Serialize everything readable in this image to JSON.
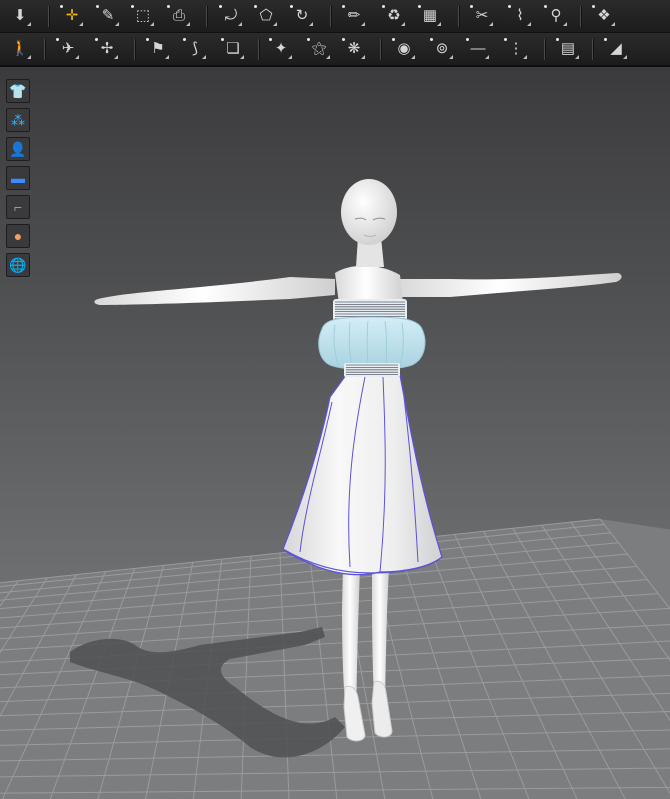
{
  "toolbar_rows": [
    {
      "name": "toolbar-row-1",
      "icons": [
        {
          "name": "download-arrow-icon",
          "glyph": "⬇"
        },
        {
          "name": "transform-move-icon",
          "glyph": "✛",
          "accent": true
        },
        {
          "name": "edit-curve-icon",
          "glyph": "✎"
        },
        {
          "name": "edit-point-icon",
          "glyph": "⬚"
        },
        {
          "name": "edit-texture-icon",
          "glyph": "⎙"
        },
        {
          "name": "segment-icon",
          "glyph": "⤾"
        },
        {
          "name": "polygon-icon",
          "glyph": "⬠"
        },
        {
          "name": "rotate-pattern-icon",
          "glyph": "↻"
        },
        {
          "name": "pencil-icon",
          "glyph": "✏"
        },
        {
          "name": "fold-arrangement-icon",
          "glyph": "♻"
        },
        {
          "name": "fabric-garment-icon",
          "glyph": "▦"
        },
        {
          "name": "sewing-icon",
          "glyph": "✂"
        },
        {
          "name": "free-sewing-icon",
          "glyph": "⌇"
        },
        {
          "name": "garment-fitting-icon",
          "glyph": "⚲"
        },
        {
          "name": "show-garment-icon",
          "glyph": "❖"
        }
      ]
    },
    {
      "name": "toolbar-row-2",
      "icons": [
        {
          "name": "simulation-avatar-icon",
          "glyph": "🚶"
        },
        {
          "name": "arrangement-icon",
          "glyph": "✈"
        },
        {
          "name": "tack-icon",
          "glyph": "✢"
        },
        {
          "name": "pin-icon",
          "glyph": "⚑"
        },
        {
          "name": "fold-icon",
          "glyph": "⟆"
        },
        {
          "name": "layer-icon",
          "glyph": "❏"
        },
        {
          "name": "select-mesh-icon",
          "glyph": "✦"
        },
        {
          "name": "strengthen-icon",
          "glyph": "⚝"
        },
        {
          "name": "pattern-grid-icon",
          "glyph": "❋"
        },
        {
          "name": "button-add-icon",
          "glyph": "◉"
        },
        {
          "name": "button-icon",
          "glyph": "⊚"
        },
        {
          "name": "topstitch-line-icon",
          "glyph": "—"
        },
        {
          "name": "zipper-icon",
          "glyph": "⋮"
        },
        {
          "name": "puckering-icon",
          "glyph": "▤"
        },
        {
          "name": "trim-icon",
          "glyph": "◢"
        }
      ]
    }
  ],
  "side_toolbar": [
    {
      "name": "garment-view-icon",
      "glyph": "👕",
      "color": "#e0e0e0"
    },
    {
      "name": "particle-distance-icon",
      "glyph": "⁂",
      "color": "#37b5ff"
    },
    {
      "name": "avatar-view-icon",
      "glyph": "👤",
      "color": "#e0e0e0"
    },
    {
      "name": "fabric-view-icon",
      "glyph": "▬",
      "color": "#3b8cff"
    },
    {
      "name": "shoe-view-icon",
      "glyph": "⌐",
      "color": "#9a9a9a"
    },
    {
      "name": "avatar-skin-icon",
      "glyph": "●",
      "color": "#f0a060"
    },
    {
      "name": "environment-globe-icon",
      "glyph": "🌐",
      "color": "#3e8ed0"
    }
  ],
  "colors": {
    "accent": "#f0b400",
    "seam_line": "#5c52d8",
    "top_fabric": "#bfe3ee",
    "avatar": "#f2f2f2",
    "skirt": "#f6f6f6"
  }
}
